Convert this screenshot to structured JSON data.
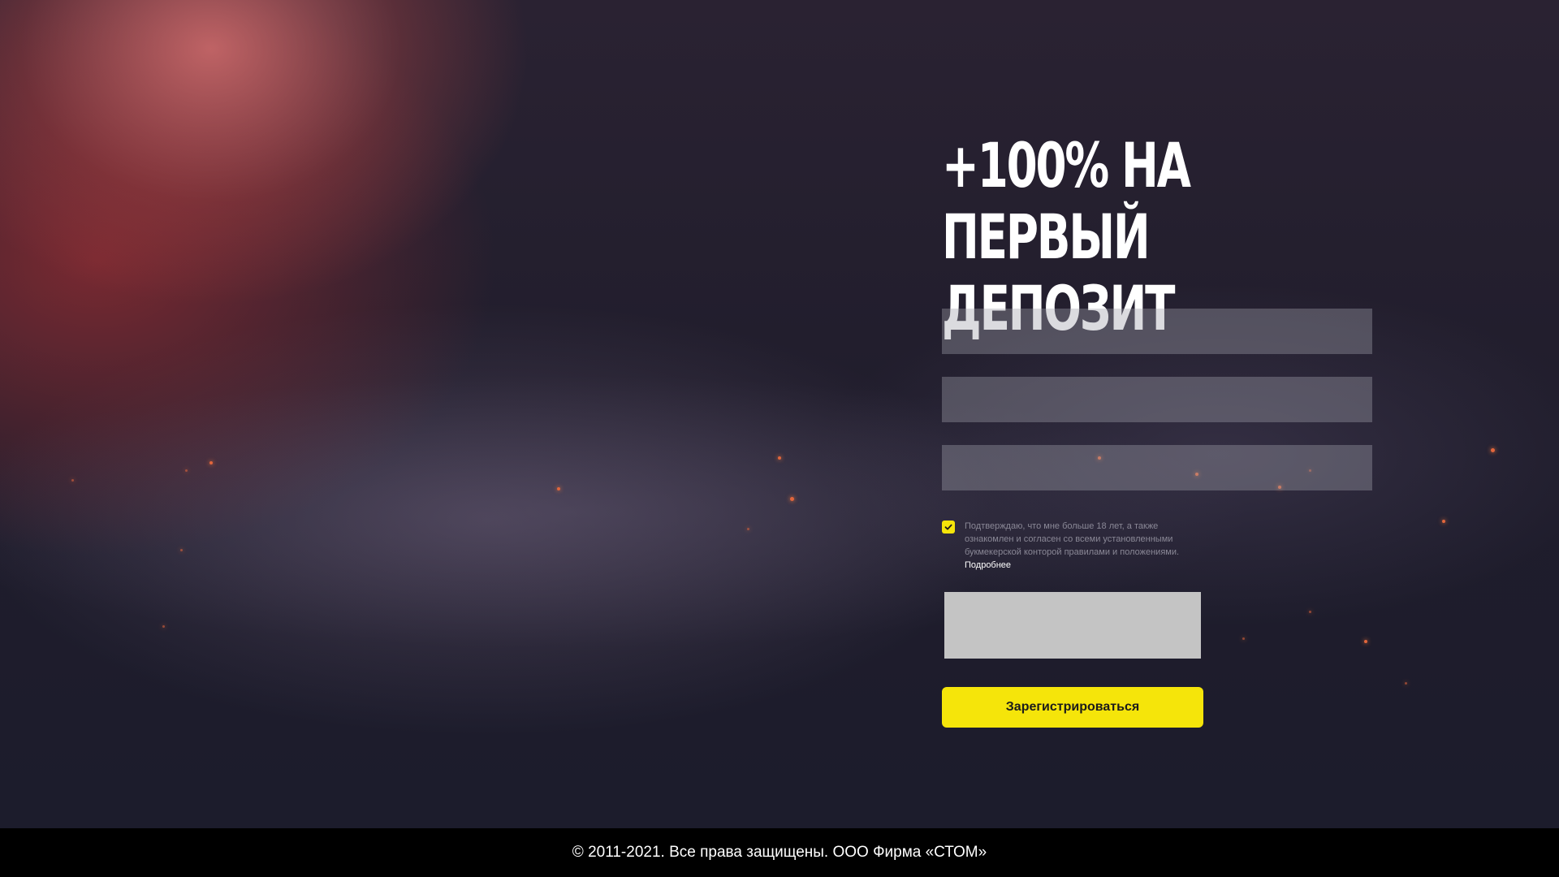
{
  "promo": {
    "title": "+100% на первый депозит"
  },
  "form": {
    "fields": [
      {
        "value": "",
        "placeholder": ""
      },
      {
        "value": "",
        "placeholder": ""
      },
      {
        "value": "",
        "placeholder": ""
      }
    ],
    "agreement": {
      "checked": true,
      "text": "Подтверждаю, что мне больше 18 лет, а также ознакомлен и согласен со всеми установленными букмекерской конторой правилами и положениями.",
      "link_label": "Подробнее"
    },
    "submit_label": "Зарегистрироваться"
  },
  "footer": {
    "copyright": "© 2011-2021. Все права защищены. ООО Фирма «СТОМ»"
  },
  "colors": {
    "accent": "#f5e50a",
    "footer_bg": "#000000"
  }
}
